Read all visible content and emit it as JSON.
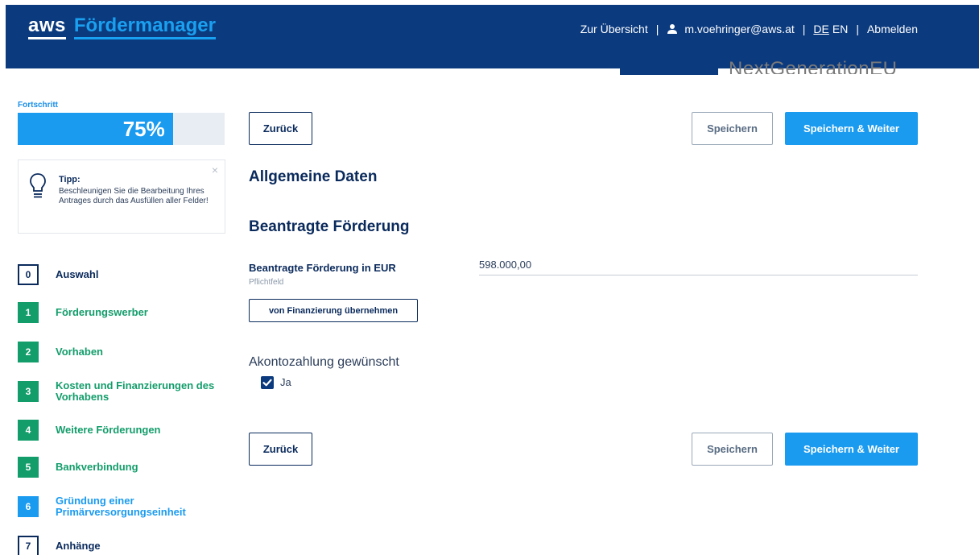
{
  "header": {
    "logo_aws": "aws",
    "logo_app": "Fördermanager",
    "overview_link": "Zur Übersicht",
    "user_email": "m.voehringer@aws.at",
    "lang_de": "DE",
    "lang_en": "EN",
    "logout": "Abmelden",
    "separator": "|"
  },
  "banner": {
    "text": "NextGenerationEU"
  },
  "sidebar": {
    "progress_label": "Fortschritt",
    "progress_value": 0.75,
    "progress_text": "75%",
    "tip": {
      "title": "Tipp:",
      "text": "Beschleunigen Sie die Bearbeitung Ihres Antrages durch das Ausfüllen aller Felder!",
      "close": "×"
    },
    "steps": [
      {
        "num": "0",
        "label": "Auswahl",
        "state": "open"
      },
      {
        "num": "1",
        "label": "Förderungswerber",
        "state": "done"
      },
      {
        "num": "2",
        "label": "Vorhaben",
        "state": "done"
      },
      {
        "num": "3",
        "label": "Kosten und Finanzierungen des Vorhabens",
        "state": "done"
      },
      {
        "num": "4",
        "label": "Weitere Förderungen",
        "state": "done"
      },
      {
        "num": "5",
        "label": "Bankverbindung",
        "state": "done"
      },
      {
        "num": "6",
        "label": "Gründung einer Primärversorgungseinheit",
        "state": "current"
      },
      {
        "num": "7",
        "label": "Anhänge",
        "state": "open"
      }
    ]
  },
  "main": {
    "back": "Zurück",
    "save": "Speichern",
    "save_next": "Speichern & Weiter",
    "section_title": "Allgemeine Daten",
    "subsection_title": "Beantragte Förderung",
    "field_label": "Beantragte Förderung in EUR",
    "field_hint": "Pflichtfeld",
    "field_value": "598.000,00",
    "take_from_financing": "von Finanzierung übernehmen",
    "akonto_label": "Akontozahlung gewünscht",
    "akonto_option": "Ja",
    "akonto_checked": true
  },
  "colors": {
    "header_bg": "#0b3a7e",
    "accent_blue": "#1a9bf0",
    "done_green": "#139d6b",
    "text_dark": "#0a2a5c"
  }
}
